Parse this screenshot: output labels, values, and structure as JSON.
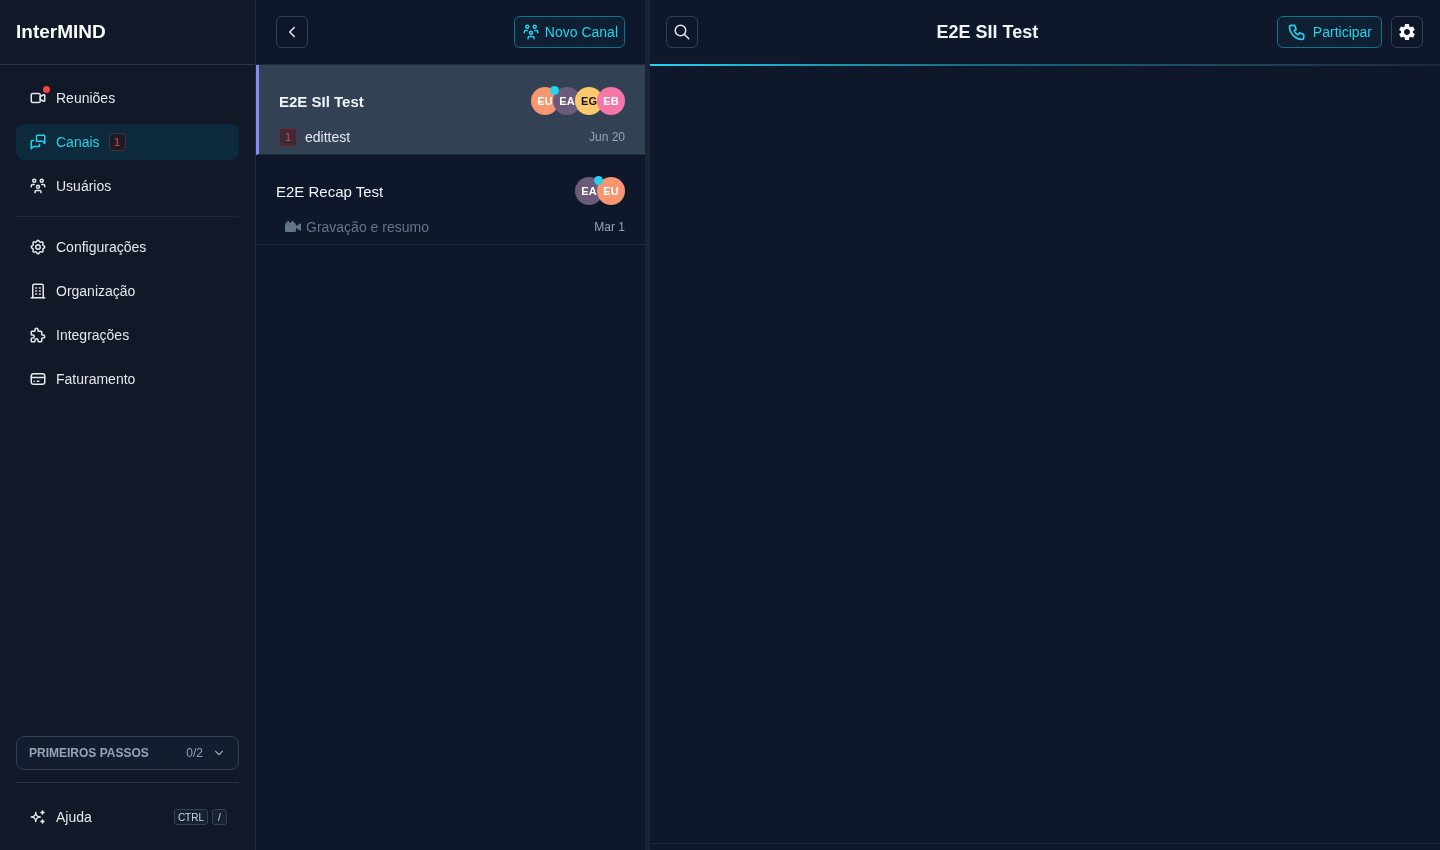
{
  "sidebar": {
    "brand": "InterMIND",
    "nav_sections": [
      {
        "items": [
          {
            "label": "Reuniões",
            "selected": false,
            "alert": true
          },
          {
            "label": "Canais",
            "selected": true,
            "alert": false,
            "badge": "1"
          },
          {
            "label": "Usuários",
            "selected": false,
            "alert": false
          }
        ]
      },
      {
        "items": [
          {
            "label": "Configurações",
            "selected": false,
            "alert": false
          },
          {
            "label": "Organização",
            "selected": false,
            "alert": false
          },
          {
            "label": "Integrações",
            "selected": false,
            "alert": false
          },
          {
            "label": "Faturamento",
            "selected": false,
            "alert": false
          }
        ]
      }
    ],
    "getting_started": {
      "label": "PRIMEIROS PASSOS",
      "progress": "0/2",
      "expanded": false
    },
    "help": {
      "label": "Ajuda",
      "shortcut": [
        "CTRL",
        "/"
      ]
    }
  },
  "channel_list": {
    "new_channel_button": "Novo Canal",
    "channels": [
      {
        "kind": "message",
        "title": "E2E SIl Test",
        "selected": true,
        "unread": true,
        "unread_count": "1",
        "preview": "edittest",
        "date": "Jun 20",
        "members": [
          {
            "initials": "EU",
            "color": "#f8966f",
            "online": true
          },
          {
            "initials": "EA",
            "color": "#6b5a7a",
            "online": false
          },
          {
            "initials": "EG",
            "color": "#fdc96a",
            "online": false
          },
          {
            "initials": "EB",
            "color": "#f676a8",
            "online": false
          }
        ]
      },
      {
        "kind": "recording",
        "title": "E2E Recap Test",
        "selected": false,
        "unread": false,
        "preview": "Gravação e resumo",
        "date": "Mar 1",
        "members": [
          {
            "initials": "EA",
            "color": "#6b5a7a",
            "online": true
          },
          {
            "initials": "EU",
            "color": "#f8966f",
            "online": false
          }
        ]
      }
    ]
  },
  "chat": {
    "title": "E2E SIl Test",
    "join_button": "Participar"
  }
}
